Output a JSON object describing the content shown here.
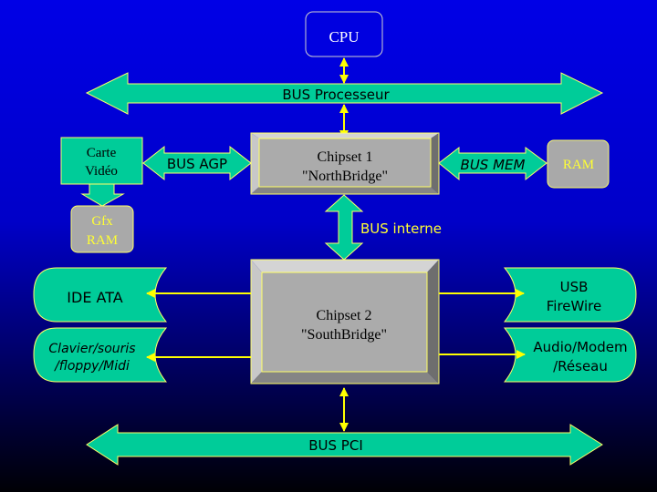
{
  "colors": {
    "background_top": "#0000e0",
    "background_bottom": "#000000",
    "bus": "#00cc99",
    "chipset": "#a9a9a9",
    "connector": "#ffff00"
  },
  "cpu": {
    "label": "CPU"
  },
  "bus_processeur": {
    "label": "BUS Processeur"
  },
  "carte_video": {
    "line1": "Carte",
    "line2": "Vidéo"
  },
  "gfx_ram": {
    "line1": "Gfx",
    "line2": "RAM"
  },
  "bus_agp": {
    "label": "BUS AGP"
  },
  "chipset1": {
    "line1": "Chipset 1",
    "line2": "\"NorthBridge\""
  },
  "bus_mem": {
    "label": "BUS MEM"
  },
  "ram": {
    "label": "RAM"
  },
  "bus_interne": {
    "label": "BUS interne"
  },
  "chipset2": {
    "line1": "Chipset 2",
    "line2": "\"SouthBridge\""
  },
  "ide": {
    "label": "IDE ATA"
  },
  "clavier": {
    "line1": "Clavier/souris",
    "line2": "/floppy/Midi"
  },
  "usb": {
    "line1": "USB",
    "line2": "FireWire"
  },
  "audio": {
    "line1": "Audio/Modem",
    "line2": "/Réseau"
  },
  "bus_pci": {
    "label": "BUS PCI"
  }
}
